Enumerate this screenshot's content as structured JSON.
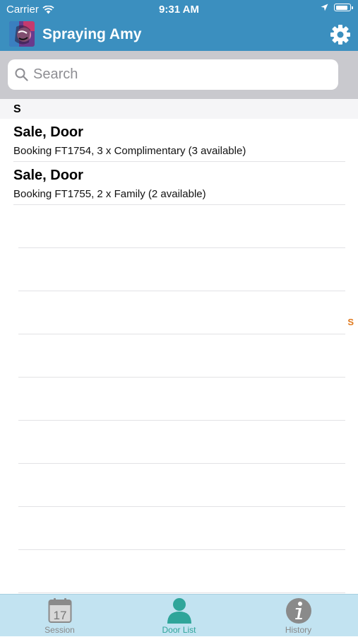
{
  "status_bar": {
    "carrier": "Carrier",
    "time": "9:31 AM",
    "battery_level": 0.9
  },
  "header": {
    "title": "Spraying Amy",
    "settings_icon": "gear-icon",
    "accent": "#3b8fbf"
  },
  "search": {
    "placeholder": "Search",
    "value": ""
  },
  "section": {
    "title": "S"
  },
  "list": {
    "items": [
      {
        "name": "Sale, Door",
        "detail": "Booking FT1754, 3 x Complimentary (3 available)"
      },
      {
        "name": "Sale, Door",
        "detail": "Booking FT1755, 2 x Family (2 available)"
      }
    ]
  },
  "index": {
    "letters": [
      "S"
    ],
    "color": "#e07a1f"
  },
  "tabs": [
    {
      "label": "Session",
      "icon": "calendar-icon",
      "badge": "17",
      "active": false
    },
    {
      "label": "Door List",
      "icon": "person-icon",
      "active": true
    },
    {
      "label": "History",
      "icon": "info-icon",
      "active": false
    }
  ],
  "colors": {
    "tab_bar": "#c2e3f1",
    "active_tab": "#2fa59a",
    "inactive_tab": "#888888"
  }
}
